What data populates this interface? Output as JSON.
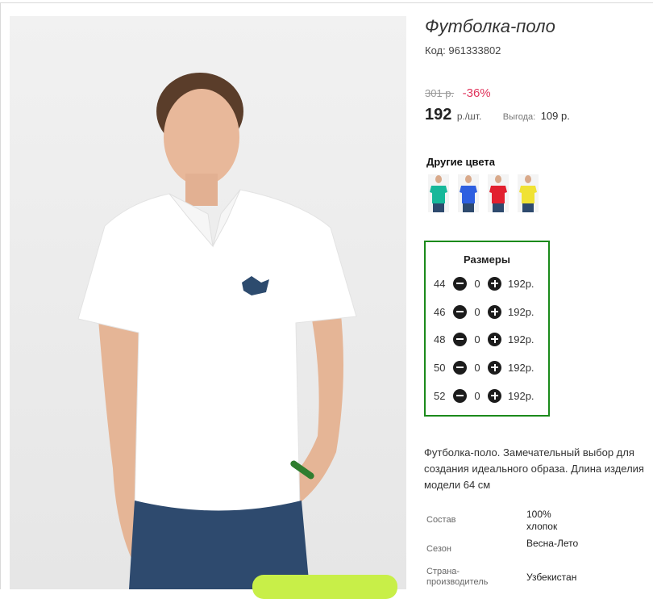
{
  "product": {
    "title": "Футболка-поло",
    "code_label": "Код:",
    "code": "961333802",
    "old_price": "301 р.",
    "discount": "-36%",
    "price": "192",
    "price_unit": "р./шт.",
    "savings_label": "Выгода:",
    "savings_value": "109 р."
  },
  "other_colors": {
    "title": "Другие цвета",
    "swatches": [
      {
        "name": "teal",
        "color": "#17b89a"
      },
      {
        "name": "blue",
        "color": "#2e5fe0"
      },
      {
        "name": "red",
        "color": "#e2202f"
      },
      {
        "name": "yellow",
        "color": "#f0e234"
      }
    ]
  },
  "sizes": {
    "title": "Размеры",
    "rows": [
      {
        "size": "44",
        "qty": "0",
        "price": "192р."
      },
      {
        "size": "46",
        "qty": "0",
        "price": "192р."
      },
      {
        "size": "48",
        "qty": "0",
        "price": "192р."
      },
      {
        "size": "50",
        "qty": "0",
        "price": "192р."
      },
      {
        "size": "52",
        "qty": "0",
        "price": "192р."
      }
    ]
  },
  "description": {
    "line1": "Футболка-поло. Замечательный выбор для",
    "line2": "создания идеального образа. Длина изделия",
    "line3": "модели 64 см"
  },
  "properties": {
    "composition_label": "Состав",
    "composition_value": "100% хлопок",
    "season_label": "Сезон",
    "season_value": "Весна-Лето",
    "country_label": "Страна-производитель",
    "country_value": "Узбекистан"
  },
  "colors": {
    "accent_green": "#1b8a1b",
    "discount_red": "#e0345c",
    "button_green": "#c8ef48"
  }
}
